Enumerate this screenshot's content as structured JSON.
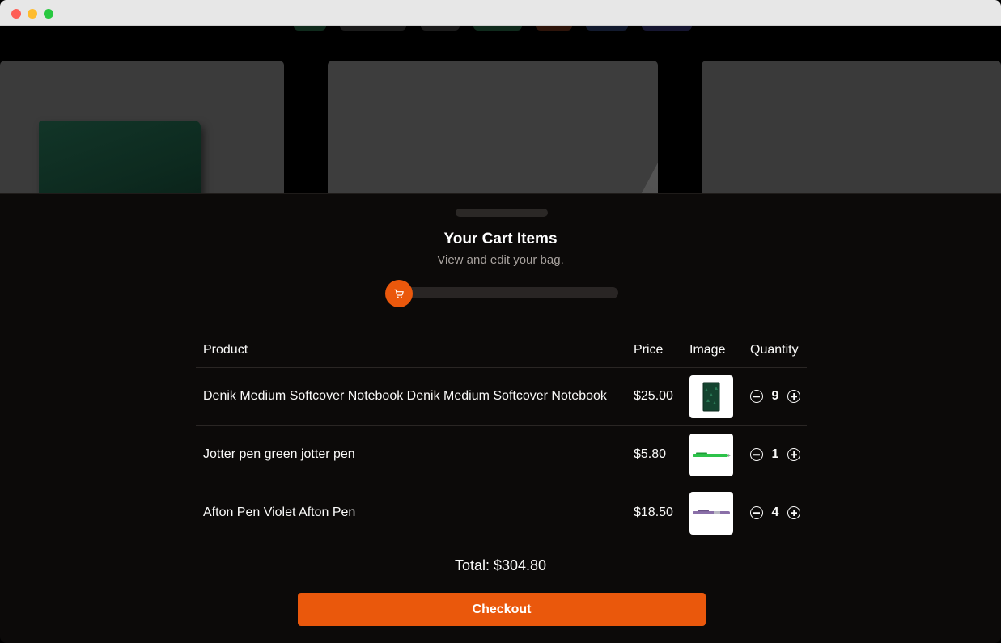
{
  "sheet": {
    "title": "Your Cart Items",
    "subtitle": "View and edit your bag.",
    "progress_icon": "shopping-cart-icon",
    "progress_fraction": 0.0
  },
  "table": {
    "headers": {
      "product": "Product",
      "price": "Price",
      "image": "Image",
      "quantity": "Quantity"
    },
    "rows": [
      {
        "name": "Denik Medium Softcover Notebook Denik Medium Softcover Notebook",
        "price": "$25.00",
        "image": "green-notebook-thumbnail",
        "quantity": "9"
      },
      {
        "name": "Jotter pen green jotter pen",
        "price": "$5.80",
        "image": "green-pen-thumbnail",
        "quantity": "1"
      },
      {
        "name": "Afton Pen Violet Afton Pen",
        "price": "$18.50",
        "image": "violet-pen-thumbnail",
        "quantity": "4"
      }
    ]
  },
  "total": "Total: $304.80",
  "checkout_label": "Checkout",
  "colors": {
    "accent": "#ea580c",
    "sheet_bg": "#0c0a09"
  }
}
